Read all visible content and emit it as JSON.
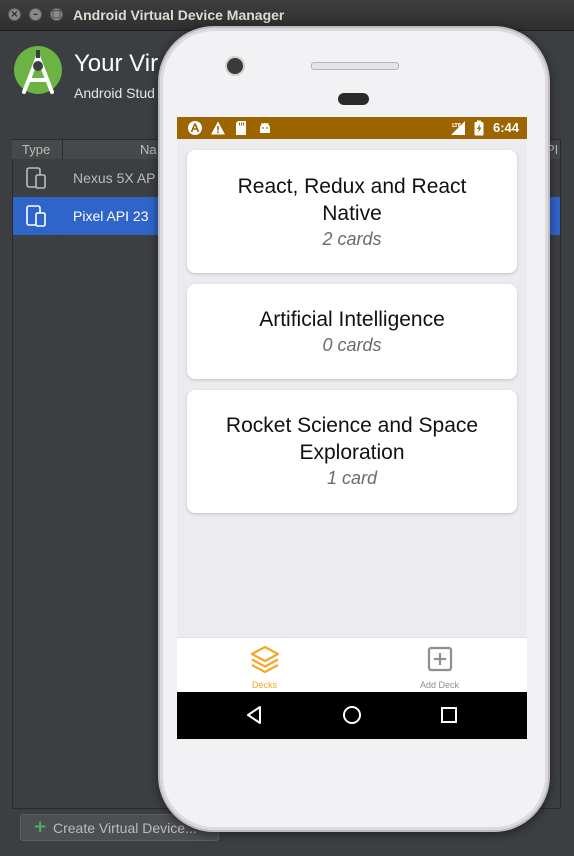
{
  "window": {
    "title": "Android Virtual Device Manager"
  },
  "header": {
    "title": "Your Vir",
    "subtitle": "Android Stud"
  },
  "table": {
    "columns": [
      "Type",
      "Na",
      "PI"
    ],
    "rows": [
      {
        "name": "Nexus 5X AP",
        "selected": false
      },
      {
        "name": "Pixel API 23",
        "selected": true
      }
    ]
  },
  "footer": {
    "create_label": "Create Virtual Device..."
  },
  "emulator": {
    "status_bar": {
      "time": "6:44",
      "background": "#9c6500"
    },
    "decks": [
      {
        "title": "React, Redux and React Native",
        "count": "2 cards"
      },
      {
        "title": "Artificial Intelligence",
        "count": "0 cards"
      },
      {
        "title": "Rocket Science and Space Exploration",
        "count": "1 card"
      }
    ],
    "tabs": [
      {
        "label": "Decks",
        "icon": "layers-icon",
        "active": true
      },
      {
        "label": "Add Deck",
        "icon": "plus-square-icon",
        "active": false
      }
    ],
    "nav": [
      "back-icon",
      "home-icon",
      "recents-icon"
    ],
    "accent": "#f5a623"
  }
}
